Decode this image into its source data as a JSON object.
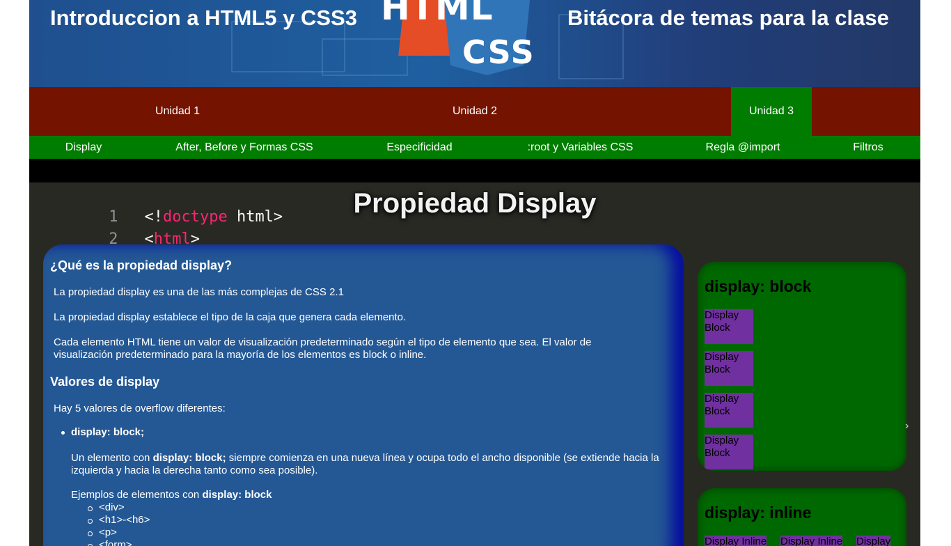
{
  "header": {
    "title_left": "Introduccion a HTML5 y CSS3",
    "title_right": "Bitácora de temas para la clase",
    "logo_html": "HTML",
    "logo_css": "CSS"
  },
  "units": [
    {
      "label": "Unidad 1",
      "active": false
    },
    {
      "label": "Unidad 2",
      "active": false
    },
    {
      "label": "Unidad 3",
      "active": true
    }
  ],
  "subnav": [
    "Display",
    "After, Before y Formas CSS",
    "Especificidad",
    ":root y Variables CSS",
    "Regla @import",
    "Filtros"
  ],
  "page_title": "Propiedad Display",
  "code_background": [
    {
      "n": "1",
      "parts": [
        [
          "tag",
          "<!"
        ],
        [
          "kw",
          "doctype"
        ],
        [
          "tag",
          " html>"
        ]
      ]
    },
    {
      "n": "2",
      "parts": [
        [
          "tag",
          "<"
        ],
        [
          "kw",
          "html"
        ],
        [
          "tag",
          ">"
        ]
      ]
    }
  ],
  "article": {
    "h_what": "¿Qué es la propiedad display?",
    "p1": "La propiedad display es una de las más complejas de CSS 2.1",
    "p2": "La propiedad display establece el tipo de la caja que genera cada elemento.",
    "p3": "Cada elemento HTML tiene un valor de visualización predeterminado según el tipo de elemento que sea. El valor de visualización predeterminado para la mayoría de los elementos es block o inline.",
    "h_values": "Valores de display",
    "p4": "Hay 5 valores de overflow diferentes:",
    "li_block_title": "display: block;",
    "block_desc_pre": "Un elemento con ",
    "block_desc_bold": "display: block;",
    "block_desc_post": " siempre comienza en una nueva línea y ocupa todo el ancho disponible (se extiende hacia la izquierda y hacia la derecha tanto como sea posible).",
    "examples_pre": "Ejemplos de elementos con ",
    "examples_bold": "display: block",
    "examples": [
      "<div>",
      "<h1>-<h6>",
      "<p>",
      "<form>"
    ]
  },
  "demo_block": {
    "title": "display: block",
    "items": [
      "Display Block",
      "Display Block",
      "Display Block",
      "Display Block"
    ]
  },
  "demo_inline": {
    "title": "display: inline",
    "items": [
      "Display Inline",
      "Display Inline",
      "Display"
    ]
  },
  "colors": {
    "header_blue": "#1f5fa0",
    "nav_red": "#731300",
    "nav_green": "#007d00",
    "article_blue": "#245ca0",
    "demo_green": "#006800",
    "demo_item_purple": "#7030a0"
  }
}
